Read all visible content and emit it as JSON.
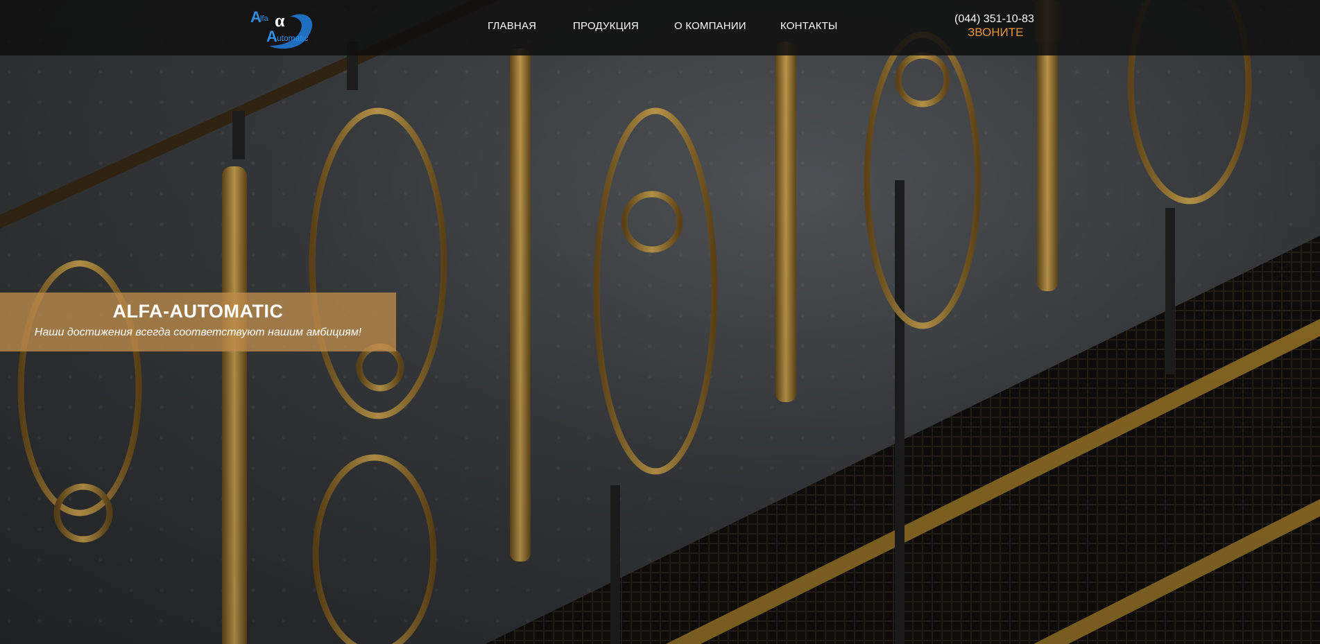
{
  "logo": {
    "letter_a1": "A",
    "text_lfa": "lfa",
    "alpha": "α",
    "letter_a2": "A",
    "text_utomatic": "utomatic"
  },
  "nav": {
    "items": [
      {
        "label": "ГЛАВНАЯ"
      },
      {
        "label": "ПРОДУКЦИЯ"
      },
      {
        "label": "О КОМПАНИИ"
      },
      {
        "label": "КОНТАКТЫ"
      }
    ]
  },
  "contact": {
    "phone": "(044) 351-10-83",
    "call_label": "ЗВОНИТЕ"
  },
  "banner": {
    "title": "ALFA-AUTOMATIC",
    "subtitle": "Наши достижения всегда соответствуют нашим амбициям!"
  },
  "colors": {
    "header_bg": "#101010",
    "accent": "#e8953a",
    "banner_bg": "#be8c4b",
    "logo_blue": "#2c8fe0",
    "gold": "#b8862e"
  },
  "icons": {
    "logo": "alfa-automatic-logo",
    "hero": "gold-balusters-staircase"
  }
}
